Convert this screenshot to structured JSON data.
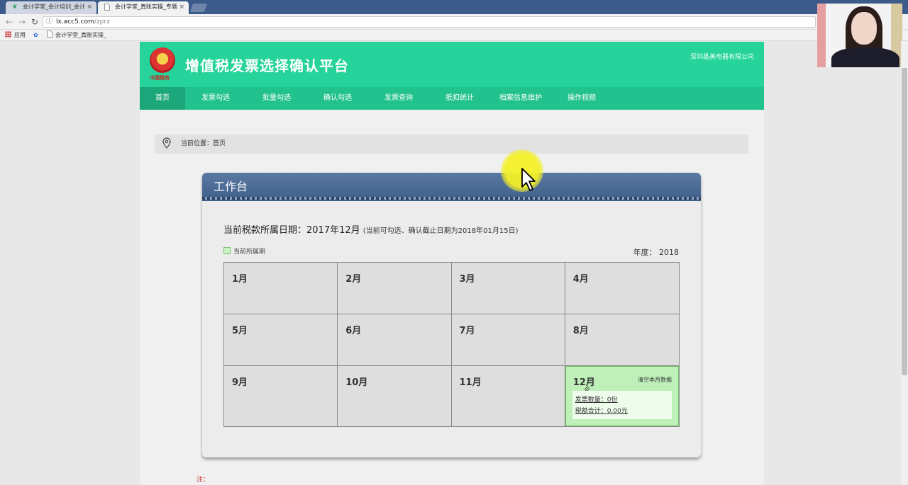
{
  "browser": {
    "tabs": [
      {
        "title": "会计学堂_会计培训_会计",
        "favicon": "leaf-icon",
        "state": "inactive"
      },
      {
        "title": "会计学堂_真账实操_专题",
        "favicon": "page-icon",
        "state": "active"
      }
    ],
    "close_glyph": "×",
    "url_host": "lx.acc5.com",
    "url_path": "/zprz",
    "bookmarks": [
      {
        "label": "应用",
        "icon": "apps-grid-icon"
      },
      {
        "label": "",
        "icon": "baidu-icon"
      },
      {
        "label": "会计学堂_真账实操_",
        "icon": "page-icon"
      }
    ]
  },
  "site": {
    "title": "增值税发票选择确认平台",
    "company": "深圳晶美电器有限公司",
    "emblem_caption": "中国税务",
    "nav": [
      {
        "label": "首页",
        "active": true
      },
      {
        "label": "发票勾选",
        "active": false
      },
      {
        "label": "批量勾选",
        "active": false
      },
      {
        "label": "确认勾选",
        "active": false
      },
      {
        "label": "发票查询",
        "active": false
      },
      {
        "label": "抵扣统计",
        "active": false
      },
      {
        "label": "档案信息维护",
        "active": false
      },
      {
        "label": "操作视频",
        "active": false
      }
    ],
    "accent": "#26d39b"
  },
  "breadcrumb": {
    "text": "当前位置：首页"
  },
  "workbench": {
    "title": "工作台",
    "tax_period_label": "当前税款所属日期：2017年12月",
    "tax_period_note": "(当前可勾选、确认截止日期为2018年01月15日)",
    "legend_label": "当前所属期",
    "year_label": "年度：",
    "year_value": "2018",
    "months": [
      "1月",
      "2月",
      "3月",
      "4月",
      "5月",
      "6月",
      "7月",
      "8月",
      "9月",
      "10月",
      "11月",
      "12月"
    ],
    "current_month": {
      "label": "12月",
      "clear_label": "清空本月数据",
      "invoice_count": "发票数量：0份",
      "tax_total": "税额合计：0.00元"
    }
  },
  "footnote": "注："
}
